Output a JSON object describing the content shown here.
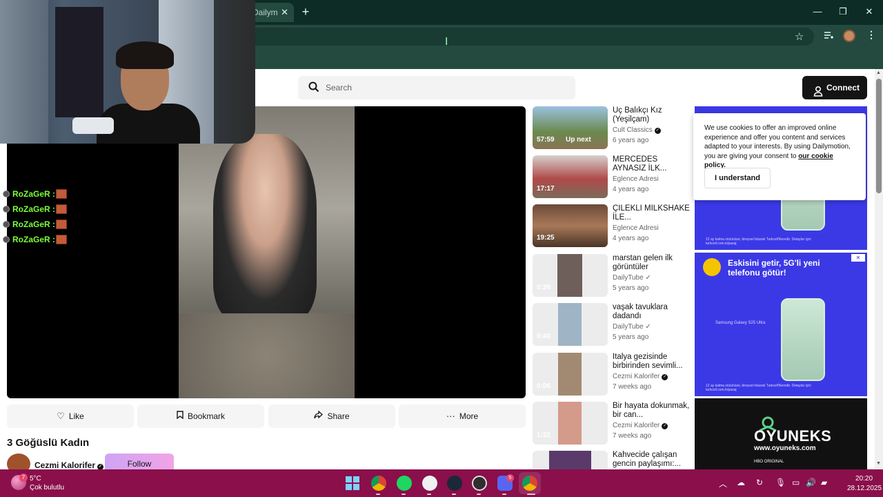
{
  "browser": {
    "tab_title": "Dailym",
    "tab_close": "✕",
    "new_tab": "+",
    "win_min": "—",
    "win_max": "❐",
    "win_close": "✕",
    "star": "☆",
    "menu": "⋮"
  },
  "site": {
    "search_placeholder": "Search",
    "connect_label": "Connect"
  },
  "chat": [
    {
      "user": "RoZaGeR :"
    },
    {
      "user": "RoZaGeR :"
    },
    {
      "user": "RoZaGeR :"
    },
    {
      "user": "RoZaGeR :"
    }
  ],
  "actions": {
    "like": "Like",
    "bookmark": "Bookmark",
    "share": "Share",
    "more": "More"
  },
  "video": {
    "title": "3 Göğüslü Kadın",
    "channel": "Cezmi Kalorifer",
    "follow": "Follow"
  },
  "related": [
    {
      "title": "Üç Balıkçı Kız (Yeşilçam)",
      "channel": "Cult Classics",
      "verified": true,
      "age": "6 years ago",
      "duration": "57:59",
      "up_next": "Up next"
    },
    {
      "title": "MERCEDES AYNASIZ İLK...",
      "channel": "Eglence Adresi",
      "verified": false,
      "age": "4 years ago",
      "duration": "17:17"
    },
    {
      "title": "ÇİLEKLİ MİLKSHAKE İLE...",
      "channel": "Eglence Adresi",
      "verified": false,
      "age": "4 years ago",
      "duration": "19:25"
    },
    {
      "title": "marstan gelen ilk görüntüler",
      "channel": "DailyTube ✓",
      "verified": false,
      "age": "5 years ago",
      "duration": "0:26"
    },
    {
      "title": "vaşak tavuklara dadandı",
      "channel": "DailyTube ✓",
      "verified": false,
      "age": "5 years ago",
      "duration": "0:40"
    },
    {
      "title": "İtalya gezisinde birbirinden sevimli...",
      "channel": "Cezmi Kalorifer",
      "verified": true,
      "age": "7 weeks ago",
      "duration": "0:06"
    },
    {
      "title": "Bir hayata dokunmak, bir can...",
      "channel": "Cezmi Kalorifer",
      "verified": true,
      "age": "7 weeks ago",
      "duration": "1:22"
    },
    {
      "title": "Kahvecide çalışan gencin paylaşımı:...",
      "channel": "",
      "verified": false,
      "age": "",
      "duration": ""
    }
  ],
  "cookie": {
    "text": "We use cookies to offer an improved online experience and offer you content and services adapted to your interests. By using Dailymotion, you are giving your consent to ",
    "link": "our cookie policy.",
    "button": "I understand"
  },
  "ads": {
    "ad1_small": "12 ay kalma sözünüze, bireysel faturalı Turkcell'lileredir. Detaylar için: turkcell.com.tr/pasaj",
    "ad2_headline": "Eskisini getir, 5G'li yeni telefonu götür!",
    "ad2_phone": "Samsung Galaxy S25 Ultra",
    "ad2_small": "12 ay kalma sözünüze, bireysel faturalı Turkcell'lileredir. Detaylar için: turkcell.com.tr/pasaj",
    "ad3_brand": "OYUNEKS",
    "ad3_url": "www.oyuneks.com",
    "ad3_hbo": "HBO ORIGINAL"
  },
  "taskbar": {
    "weather_badge": "7",
    "temp": "5°C",
    "weather_desc": "Çok bulutlu",
    "discord_badge": "5",
    "time": "20:20",
    "date": "28.12.2025"
  },
  "colors": {
    "accent_page_button": "#141414",
    "taskbar": "#8a0f4b",
    "chat_name": "#7cff3a",
    "ad_bg": "#3b39e6"
  }
}
